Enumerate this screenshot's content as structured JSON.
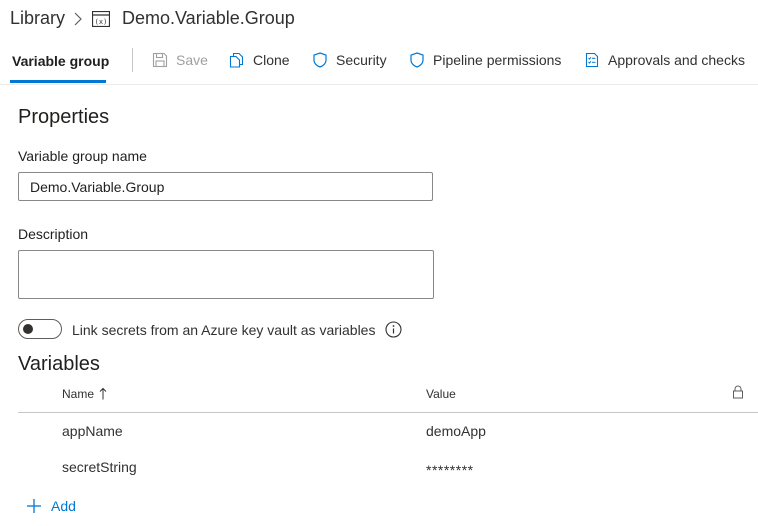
{
  "breadcrumb": {
    "root": "Library",
    "current": "Demo.Variable.Group"
  },
  "tabs": {
    "active": "Variable group"
  },
  "toolbar": {
    "save": "Save",
    "clone": "Clone",
    "security": "Security",
    "pipeline_permissions": "Pipeline permissions",
    "approvals": "Approvals and checks"
  },
  "properties": {
    "heading": "Properties",
    "name_label": "Variable group name",
    "name_value": "Demo.Variable.Group",
    "description_label": "Description",
    "description_value": "",
    "link_secrets_label": "Link secrets from an Azure key vault as variables",
    "link_secrets_enabled": false
  },
  "variables": {
    "heading": "Variables",
    "columns": {
      "name": "Name",
      "value": "Value"
    },
    "rows": [
      {
        "name": "appName",
        "value": "demoApp"
      },
      {
        "name": "secretString",
        "value": "********"
      }
    ],
    "add_label": "Add"
  },
  "colors": {
    "accent": "#0078d4",
    "text": "#323130",
    "disabled": "#a19f9d"
  },
  "icons": {
    "group": "variable-group-icon",
    "save": "save-icon",
    "clone": "clone-icon",
    "security": "shield-icon",
    "pipeline": "shield-icon",
    "approvals": "checklist-icon",
    "info": "info-icon",
    "sort": "sort-up-icon",
    "lock": "lock-icon",
    "add": "plus-icon"
  }
}
